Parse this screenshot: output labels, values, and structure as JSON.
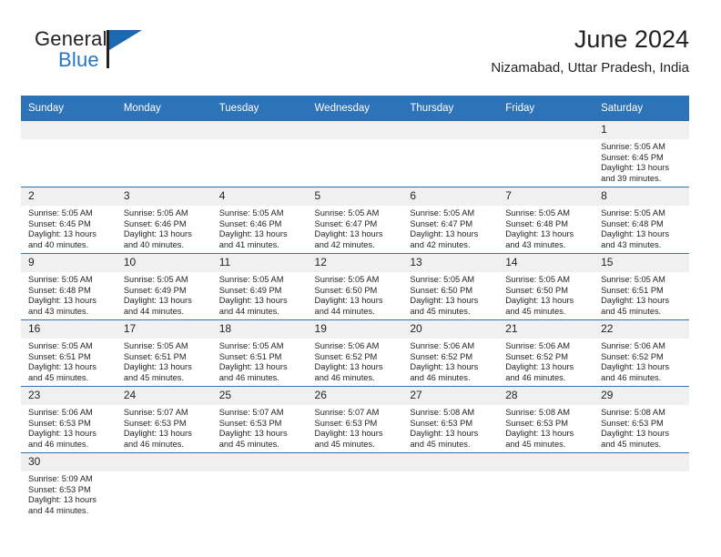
{
  "brand": {
    "name_part1": "General",
    "name_part2": "Blue"
  },
  "header": {
    "month_title": "June 2024",
    "location": "Nizamabad, Uttar Pradesh, India"
  },
  "colors": {
    "header_blue": "#2e72b8",
    "brand_blue": "#2277c8",
    "daynum_band": "#f0f0f0",
    "text": "#231f20"
  },
  "calendar": {
    "weekday_headers": [
      "Sunday",
      "Monday",
      "Tuesday",
      "Wednesday",
      "Thursday",
      "Friday",
      "Saturday"
    ],
    "weeks": [
      [
        {
          "day": "",
          "empty": true
        },
        {
          "day": "",
          "empty": true
        },
        {
          "day": "",
          "empty": true
        },
        {
          "day": "",
          "empty": true
        },
        {
          "day": "",
          "empty": true
        },
        {
          "day": "",
          "empty": true
        },
        {
          "day": "1",
          "sunrise": "Sunrise: 5:05 AM",
          "sunset": "Sunset: 6:45 PM",
          "daylight": "Daylight: 13 hours and 39 minutes."
        }
      ],
      [
        {
          "day": "2",
          "sunrise": "Sunrise: 5:05 AM",
          "sunset": "Sunset: 6:45 PM",
          "daylight": "Daylight: 13 hours and 40 minutes."
        },
        {
          "day": "3",
          "sunrise": "Sunrise: 5:05 AM",
          "sunset": "Sunset: 6:46 PM",
          "daylight": "Daylight: 13 hours and 40 minutes."
        },
        {
          "day": "4",
          "sunrise": "Sunrise: 5:05 AM",
          "sunset": "Sunset: 6:46 PM",
          "daylight": "Daylight: 13 hours and 41 minutes."
        },
        {
          "day": "5",
          "sunrise": "Sunrise: 5:05 AM",
          "sunset": "Sunset: 6:47 PM",
          "daylight": "Daylight: 13 hours and 42 minutes."
        },
        {
          "day": "6",
          "sunrise": "Sunrise: 5:05 AM",
          "sunset": "Sunset: 6:47 PM",
          "daylight": "Daylight: 13 hours and 42 minutes."
        },
        {
          "day": "7",
          "sunrise": "Sunrise: 5:05 AM",
          "sunset": "Sunset: 6:48 PM",
          "daylight": "Daylight: 13 hours and 43 minutes."
        },
        {
          "day": "8",
          "sunrise": "Sunrise: 5:05 AM",
          "sunset": "Sunset: 6:48 PM",
          "daylight": "Daylight: 13 hours and 43 minutes."
        }
      ],
      [
        {
          "day": "9",
          "sunrise": "Sunrise: 5:05 AM",
          "sunset": "Sunset: 6:48 PM",
          "daylight": "Daylight: 13 hours and 43 minutes."
        },
        {
          "day": "10",
          "sunrise": "Sunrise: 5:05 AM",
          "sunset": "Sunset: 6:49 PM",
          "daylight": "Daylight: 13 hours and 44 minutes."
        },
        {
          "day": "11",
          "sunrise": "Sunrise: 5:05 AM",
          "sunset": "Sunset: 6:49 PM",
          "daylight": "Daylight: 13 hours and 44 minutes."
        },
        {
          "day": "12",
          "sunrise": "Sunrise: 5:05 AM",
          "sunset": "Sunset: 6:50 PM",
          "daylight": "Daylight: 13 hours and 44 minutes."
        },
        {
          "day": "13",
          "sunrise": "Sunrise: 5:05 AM",
          "sunset": "Sunset: 6:50 PM",
          "daylight": "Daylight: 13 hours and 45 minutes."
        },
        {
          "day": "14",
          "sunrise": "Sunrise: 5:05 AM",
          "sunset": "Sunset: 6:50 PM",
          "daylight": "Daylight: 13 hours and 45 minutes."
        },
        {
          "day": "15",
          "sunrise": "Sunrise: 5:05 AM",
          "sunset": "Sunset: 6:51 PM",
          "daylight": "Daylight: 13 hours and 45 minutes."
        }
      ],
      [
        {
          "day": "16",
          "sunrise": "Sunrise: 5:05 AM",
          "sunset": "Sunset: 6:51 PM",
          "daylight": "Daylight: 13 hours and 45 minutes."
        },
        {
          "day": "17",
          "sunrise": "Sunrise: 5:05 AM",
          "sunset": "Sunset: 6:51 PM",
          "daylight": "Daylight: 13 hours and 45 minutes."
        },
        {
          "day": "18",
          "sunrise": "Sunrise: 5:05 AM",
          "sunset": "Sunset: 6:51 PM",
          "daylight": "Daylight: 13 hours and 46 minutes."
        },
        {
          "day": "19",
          "sunrise": "Sunrise: 5:06 AM",
          "sunset": "Sunset: 6:52 PM",
          "daylight": "Daylight: 13 hours and 46 minutes."
        },
        {
          "day": "20",
          "sunrise": "Sunrise: 5:06 AM",
          "sunset": "Sunset: 6:52 PM",
          "daylight": "Daylight: 13 hours and 46 minutes."
        },
        {
          "day": "21",
          "sunrise": "Sunrise: 5:06 AM",
          "sunset": "Sunset: 6:52 PM",
          "daylight": "Daylight: 13 hours and 46 minutes."
        },
        {
          "day": "22",
          "sunrise": "Sunrise: 5:06 AM",
          "sunset": "Sunset: 6:52 PM",
          "daylight": "Daylight: 13 hours and 46 minutes."
        }
      ],
      [
        {
          "day": "23",
          "sunrise": "Sunrise: 5:06 AM",
          "sunset": "Sunset: 6:53 PM",
          "daylight": "Daylight: 13 hours and 46 minutes."
        },
        {
          "day": "24",
          "sunrise": "Sunrise: 5:07 AM",
          "sunset": "Sunset: 6:53 PM",
          "daylight": "Daylight: 13 hours and 46 minutes."
        },
        {
          "day": "25",
          "sunrise": "Sunrise: 5:07 AM",
          "sunset": "Sunset: 6:53 PM",
          "daylight": "Daylight: 13 hours and 45 minutes."
        },
        {
          "day": "26",
          "sunrise": "Sunrise: 5:07 AM",
          "sunset": "Sunset: 6:53 PM",
          "daylight": "Daylight: 13 hours and 45 minutes."
        },
        {
          "day": "27",
          "sunrise": "Sunrise: 5:08 AM",
          "sunset": "Sunset: 6:53 PM",
          "daylight": "Daylight: 13 hours and 45 minutes."
        },
        {
          "day": "28",
          "sunrise": "Sunrise: 5:08 AM",
          "sunset": "Sunset: 6:53 PM",
          "daylight": "Daylight: 13 hours and 45 minutes."
        },
        {
          "day": "29",
          "sunrise": "Sunrise: 5:08 AM",
          "sunset": "Sunset: 6:53 PM",
          "daylight": "Daylight: 13 hours and 45 minutes."
        }
      ],
      [
        {
          "day": "30",
          "sunrise": "Sunrise: 5:09 AM",
          "sunset": "Sunset: 6:53 PM",
          "daylight": "Daylight: 13 hours and 44 minutes."
        },
        {
          "day": "",
          "empty": true
        },
        {
          "day": "",
          "empty": true
        },
        {
          "day": "",
          "empty": true
        },
        {
          "day": "",
          "empty": true
        },
        {
          "day": "",
          "empty": true
        },
        {
          "day": "",
          "empty": true
        }
      ]
    ]
  }
}
